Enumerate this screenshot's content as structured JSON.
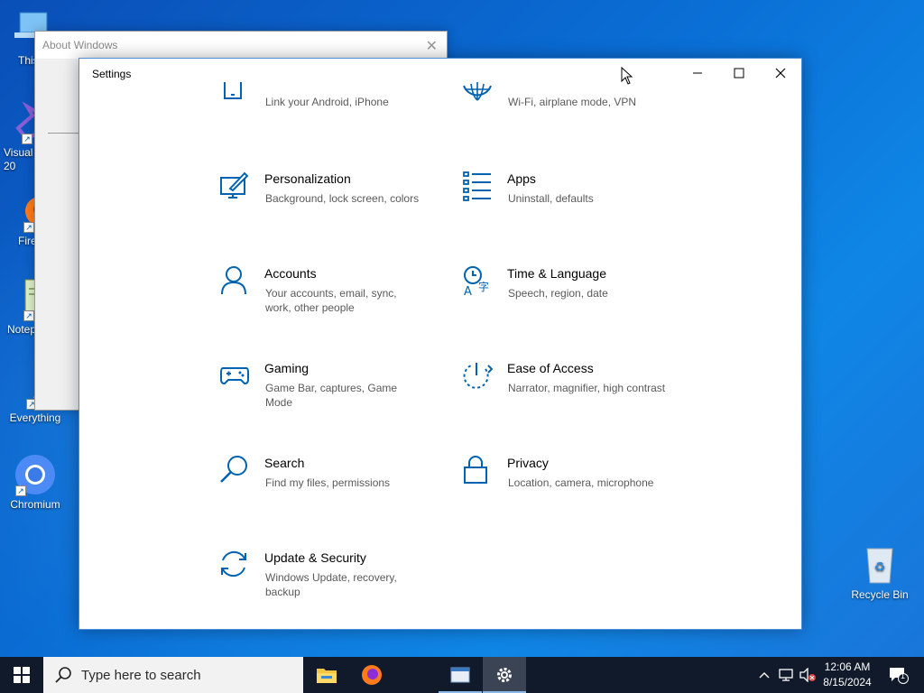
{
  "desktop": {
    "icons": [
      {
        "label": "This"
      },
      {
        "label": "Visual\n20"
      },
      {
        "label": "Fire"
      },
      {
        "label": "Notep"
      },
      {
        "label": "Everything"
      },
      {
        "label": "Chromium"
      },
      {
        "label": "Recycle Bin"
      }
    ]
  },
  "about_window": {
    "title": "About Windows"
  },
  "settings_window": {
    "title": "Settings",
    "tiles": [
      {
        "title": "",
        "desc": "Link your Android, iPhone",
        "icon": "phone-icon"
      },
      {
        "title": "",
        "desc": "Wi-Fi, airplane mode, VPN",
        "icon": "globe-icon"
      },
      {
        "title": "Personalization",
        "desc": "Background, lock screen, colors",
        "icon": "personalization-icon"
      },
      {
        "title": "Apps",
        "desc": "Uninstall, defaults",
        "icon": "apps-icon"
      },
      {
        "title": "Accounts",
        "desc": "Your accounts, email, sync, work, other people",
        "icon": "person-icon"
      },
      {
        "title": "Time & Language",
        "desc": "Speech, region, date",
        "icon": "time-language-icon"
      },
      {
        "title": "Gaming",
        "desc": "Game Bar, captures, Game Mode",
        "icon": "gamepad-icon"
      },
      {
        "title": "Ease of Access",
        "desc": "Narrator, magnifier, high contrast",
        "icon": "ease-of-access-icon"
      },
      {
        "title": "Search",
        "desc": "Find my files, permissions",
        "icon": "search-icon"
      },
      {
        "title": "Privacy",
        "desc": "Location, camera, microphone",
        "icon": "lock-icon"
      },
      {
        "title": "Update & Security",
        "desc": "Windows Update, recovery, backup",
        "icon": "update-icon"
      }
    ]
  },
  "taskbar": {
    "search_placeholder": "Type here to search",
    "time": "12:06 AM",
    "date": "8/15/2024",
    "notification_count": "1"
  },
  "colors": {
    "accent": "#0063b1",
    "taskbar": "#101a2a"
  }
}
